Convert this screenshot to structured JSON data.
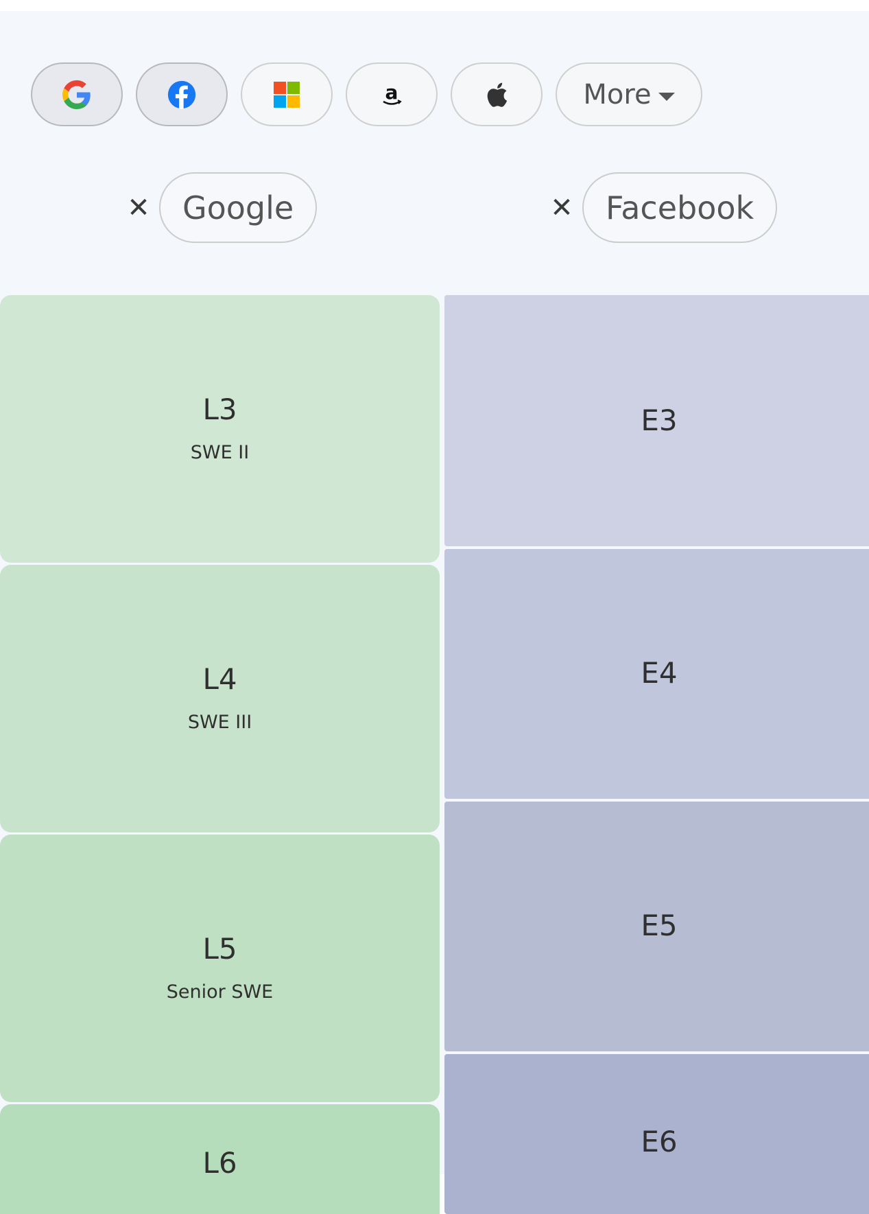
{
  "company_bar": {
    "logos": [
      {
        "icon": "google-icon",
        "selected": true
      },
      {
        "icon": "facebook-icon",
        "selected": true
      },
      {
        "icon": "microsoft-icon",
        "selected": false
      },
      {
        "icon": "amazon-icon",
        "selected": false
      },
      {
        "icon": "apple-icon",
        "selected": false
      }
    ],
    "more_label": "More"
  },
  "selected_companies": [
    {
      "name": "Google",
      "remove": "✕"
    },
    {
      "name": "Facebook",
      "remove": "✕"
    }
  ],
  "google_levels": [
    {
      "name": "L3",
      "title": "SWE II",
      "color": "#cfe7d3"
    },
    {
      "name": "L4",
      "title": "SWE III",
      "color": "#c8e3cc"
    },
    {
      "name": "L5",
      "title": "Senior SWE",
      "color": "#bfe0c3"
    },
    {
      "name": "L6",
      "title": "",
      "color": "#b6ddbb"
    }
  ],
  "facebook_levels": [
    {
      "name": "E3",
      "color": "#cdd1e3"
    },
    {
      "name": "E4",
      "color": "#c0c7dc"
    },
    {
      "name": "E5",
      "color": "#b6bdd3"
    },
    {
      "name": "E6",
      "color": "#aab2cf"
    }
  ]
}
